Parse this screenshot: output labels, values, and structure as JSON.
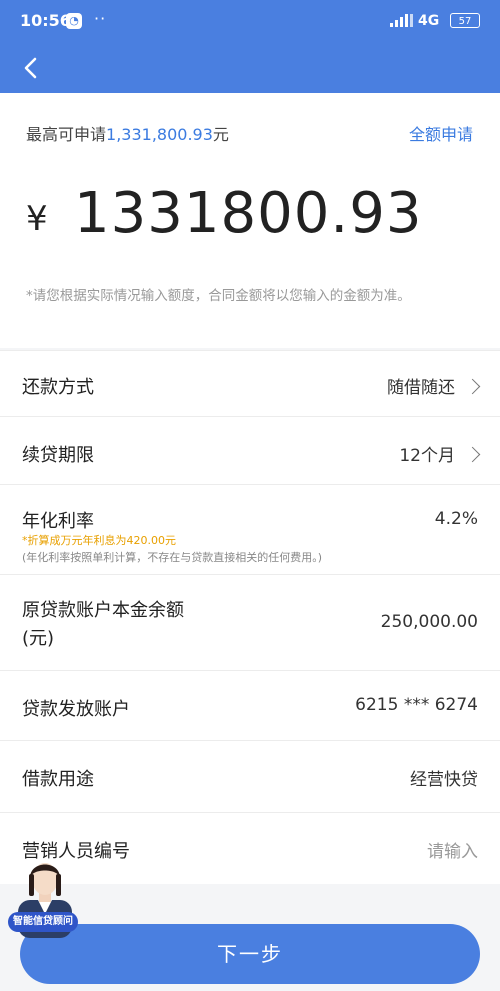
{
  "status_bar": {
    "time": "10:56",
    "network": "4G",
    "battery": "57"
  },
  "summary": {
    "max_label": "最高可申请",
    "max_amount": "1,331,800.93",
    "max_unit": "元",
    "full_apply": "全额申请",
    "currency": "¥",
    "amount": "1331800.93",
    "note": "*请您根据实际情况输入额度，合同金额将以您输入的金额为准。"
  },
  "form": {
    "repay_method": {
      "label": "还款方式",
      "value": "随借随还"
    },
    "term": {
      "label": "续贷期限",
      "value": "12个月"
    },
    "rate": {
      "label": "年化利率",
      "value": "4.2%",
      "sub1": "*折算成万元年利息为420.00元",
      "sub2": "(年化利率按照单利计算，不存在与贷款直接相关的任何费用。)"
    },
    "principal": {
      "label_line1": "原贷款账户本金余额",
      "label_line2": "(元)",
      "value": "250,000.00"
    },
    "account": {
      "label": "贷款发放账户",
      "value": "6215 *** 6274"
    },
    "purpose": {
      "label": "借款用途",
      "value": "经营快贷"
    },
    "staff": {
      "label": "营销人员编号",
      "placeholder": "请输入"
    }
  },
  "advisor": {
    "badge": "智能信贷顾问"
  },
  "footer": {
    "next": "下一步"
  },
  "colors": {
    "primary": "#4a7fe0",
    "accent_text": "#3b7be0",
    "orange": "#e8a000"
  }
}
